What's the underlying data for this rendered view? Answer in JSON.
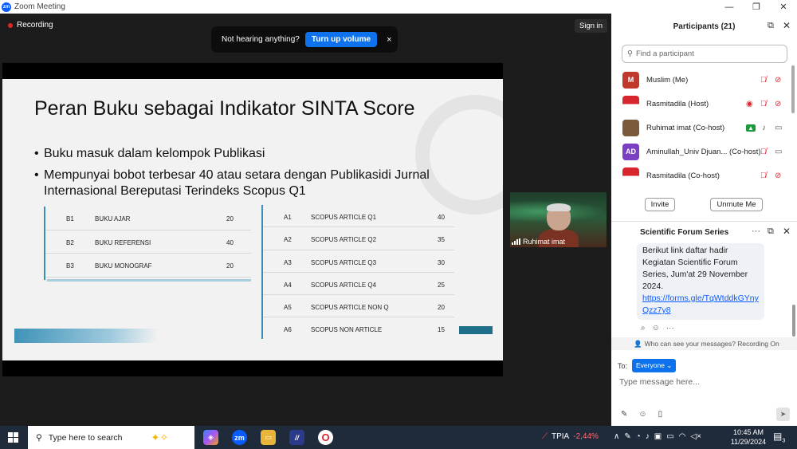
{
  "window": {
    "title": "Zoom Meeting",
    "logo": "zm",
    "min": "—",
    "restore": "❐",
    "close": "✕"
  },
  "meeting": {
    "recording_label": "Recording",
    "signin_label": "Sign in",
    "banner": {
      "message": "Not hearing anything?",
      "button": "Turn up volume",
      "close": "×"
    }
  },
  "slide": {
    "title": "Peran Buku sebagai Indikator SINTA Score",
    "bullets": [
      "Buku masuk dalam kelompok Publikasi",
      "Mempunyai bobot terbesar 40 atau setara dengan Publikasidi Jurnal",
      "Internasional Bereputasi Terindeks Scopus Q1"
    ],
    "table_left": [
      {
        "code": "B1",
        "name": "BUKU AJAR",
        "score": "20"
      },
      {
        "code": "B2",
        "name": "BUKU REFERENSI",
        "score": "40"
      },
      {
        "code": "B3",
        "name": "BUKU MONOGRAF",
        "score": "20"
      }
    ],
    "table_right": [
      {
        "code": "A1",
        "name": "SCOPUS ARTICLE Q1",
        "score": "40"
      },
      {
        "code": "A2",
        "name": "SCOPUS ARTICLE Q2",
        "score": "35"
      },
      {
        "code": "A3",
        "name": "SCOPUS ARTICLE Q3",
        "score": "30"
      },
      {
        "code": "A4",
        "name": "SCOPUS ARTICLE Q4",
        "score": "25"
      },
      {
        "code": "A5",
        "name": "SCOPUS ARTICLE NON Q",
        "score": "20"
      },
      {
        "code": "A6",
        "name": "SCOPUS NON ARTICLE",
        "score": "15"
      }
    ]
  },
  "video": {
    "name": "Ruhimat imat"
  },
  "participants": {
    "title": "Participants (21)",
    "search_placeholder": "Find a participant",
    "list": [
      {
        "initials": "M",
        "name": "Muslim (Me)",
        "color": "#c0392b"
      },
      {
        "initials": "",
        "name": "Rasmitadila (Host)",
        "color": "#d8262e"
      },
      {
        "initials": "",
        "name": "Ruhimat imat (Co-host)",
        "color": "#7a5a3a"
      },
      {
        "initials": "AD",
        "name": "Aminullah_Univ Djuan... (Co-host)",
        "color": "#7b3fc4"
      },
      {
        "initials": "",
        "name": "Rasmitadila (Co-host)",
        "color": "#d8262e"
      }
    ],
    "invite_label": "Invite",
    "unmute_label": "Unmute Me"
  },
  "chat": {
    "title": "Scientific Forum Series",
    "message_lines": [
      "Berikut link daftar hadir",
      "Kegiatan Scientific Forum",
      "Series, Jum'at 29 November",
      "2024."
    ],
    "link": "https://forms.gle/TqWtddkGYnyQzz7y8",
    "visibility_note": "Who can see your messages? Recording On",
    "to_label": "To:",
    "recipient": "Everyone",
    "placeholder": "Type message here..."
  },
  "taskbar": {
    "search_placeholder": "Type here to search",
    "stock": {
      "ticker": "TPIA",
      "change": "-2,44%"
    },
    "time": "10:45 AM",
    "date": "11/29/2024",
    "notification_count": "3"
  }
}
